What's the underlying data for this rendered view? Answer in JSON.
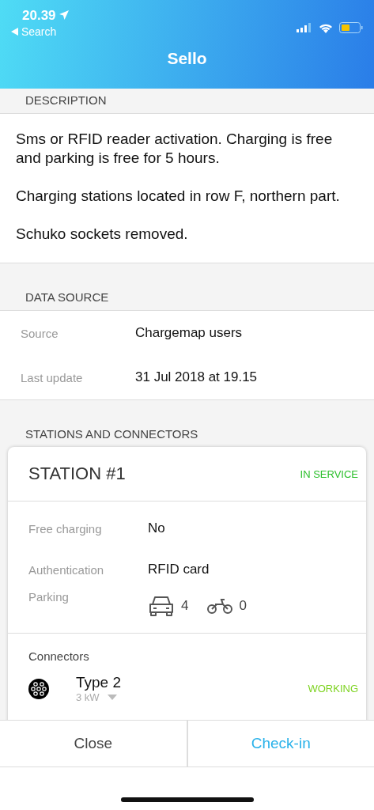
{
  "status_bar": {
    "time": "20.39",
    "back_label": "Search"
  },
  "nav": {
    "title": "Sello"
  },
  "description": {
    "heading": "DESCRIPTION",
    "paragraphs": [
      "Sms or RFID reader activation. Charging is free and parking is free for 5 hours.",
      "Charging stations located in row F, northern part.",
      "Schuko sockets removed."
    ]
  },
  "data_source": {
    "heading": "DATA SOURCE",
    "rows": [
      {
        "label": "Source",
        "value": "Chargemap users"
      },
      {
        "label": "Last update",
        "value": "31 Jul 2018 at 19.15"
      }
    ]
  },
  "stations": {
    "heading": "STATIONS AND CONNECTORS",
    "station": {
      "title": "STATION #1",
      "status": "IN SERVICE",
      "details": [
        {
          "label": "Free charging",
          "value": "No"
        },
        {
          "label": "Authentication",
          "value": "RFID card"
        }
      ],
      "parking": {
        "label": "Parking",
        "cars": "4",
        "motorbikes": "0"
      },
      "connectors_heading": "Connectors",
      "connectors": [
        {
          "name": "Type 2",
          "power": "3 kW",
          "status": "WORKING"
        }
      ]
    }
  },
  "buttons": [
    {
      "label": "Close",
      "kind": "plain"
    },
    {
      "label": "Check-in",
      "kind": "primary"
    }
  ]
}
